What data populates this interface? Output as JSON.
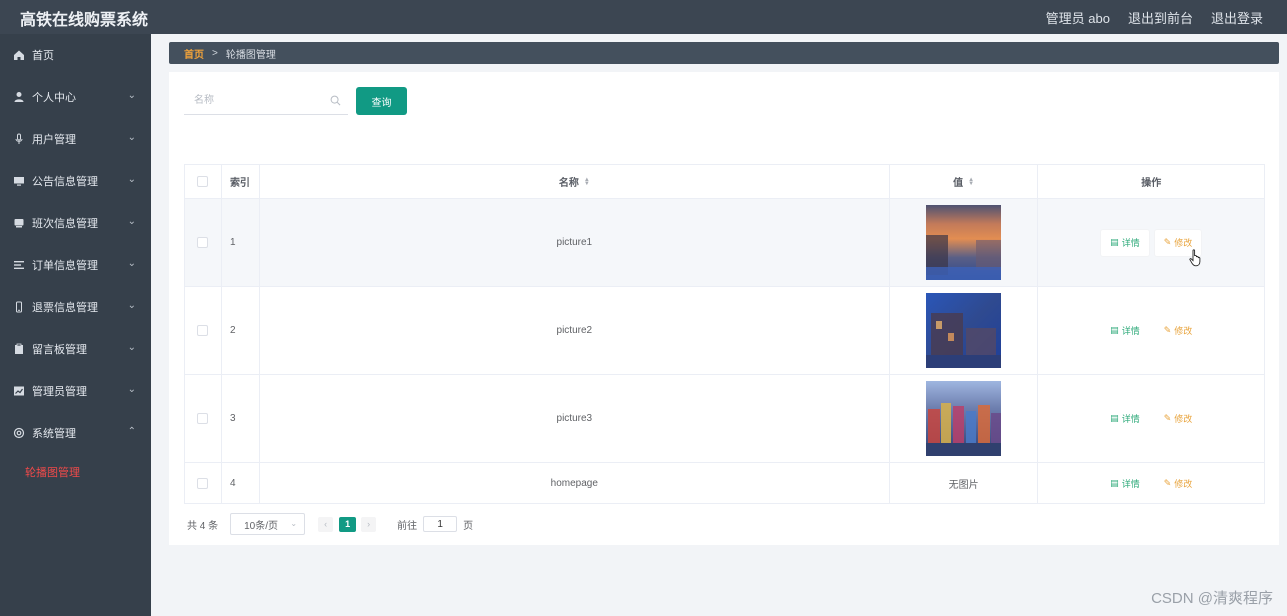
{
  "header": {
    "title": "高铁在线购票系统",
    "admin": "管理员 abo",
    "to_front": "退出到前台",
    "logout": "退出登录"
  },
  "sidebar": {
    "items": [
      {
        "label": "首页",
        "icon": "home-icon"
      },
      {
        "label": "个人中心",
        "icon": "user-icon"
      },
      {
        "label": "用户管理",
        "icon": "microphone-icon"
      },
      {
        "label": "公告信息管理",
        "icon": "monitor-icon"
      },
      {
        "label": "班次信息管理",
        "icon": "train-icon"
      },
      {
        "label": "订单信息管理",
        "icon": "list-icon"
      },
      {
        "label": "退票信息管理",
        "icon": "phone-icon"
      },
      {
        "label": "留言板管理",
        "icon": "clipboard-icon"
      },
      {
        "label": "管理员管理",
        "icon": "chart-icon"
      },
      {
        "label": "系统管理",
        "icon": "settings-icon"
      }
    ],
    "sub_item": "轮播图管理"
  },
  "breadcrumb": {
    "home": "首页",
    "separator": ">",
    "current": "轮播图管理"
  },
  "search": {
    "placeholder": "名称",
    "button": "查询"
  },
  "table": {
    "headers": {
      "index": "索引",
      "name": "名称",
      "value": "值",
      "action": "操作"
    },
    "rows": [
      {
        "index": "1",
        "name": "picture1",
        "value": "",
        "has_image": true
      },
      {
        "index": "2",
        "name": "picture2",
        "value": "",
        "has_image": true
      },
      {
        "index": "3",
        "name": "picture3",
        "value": "",
        "has_image": true
      },
      {
        "index": "4",
        "name": "homepage",
        "value": "无图片",
        "has_image": false
      }
    ],
    "detail_label": "详情",
    "edit_label": "修改"
  },
  "pagination": {
    "total": "共 4 条",
    "page_size": "10条/页",
    "current_page": "1",
    "goto_label": "前往",
    "goto_value": "1",
    "goto_unit": "页"
  },
  "watermark": "CSDN @清爽程序",
  "colors": {
    "topbar": "#3c4652",
    "sidebar": "#36404b",
    "primary": "#119a84",
    "active_sub": "#f04a4a",
    "detail": "#2eaa7a",
    "edit": "#e8a33b"
  }
}
